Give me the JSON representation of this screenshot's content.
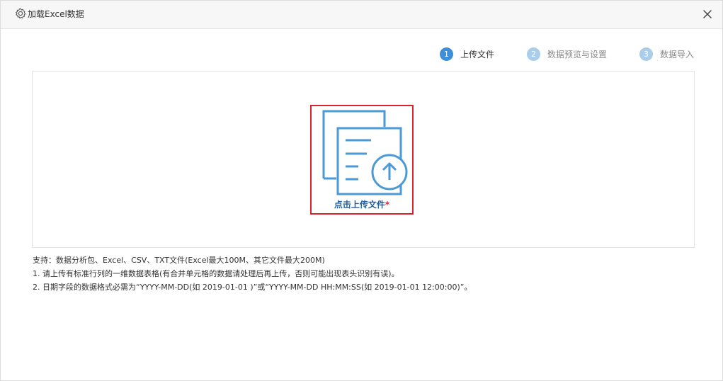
{
  "dialog": {
    "title": "加载Excel数据",
    "title_icon": "gear-icon",
    "close_icon": "close-icon"
  },
  "steps": [
    {
      "num": "1",
      "label": "上传文件",
      "state": "active"
    },
    {
      "num": "2",
      "label": "数据预览与设置",
      "state": "inactive"
    },
    {
      "num": "3",
      "label": "数据导入",
      "state": "inactive"
    }
  ],
  "upload": {
    "label": "点击上传文件",
    "required_mark": "*",
    "icon": "upload-file-icon"
  },
  "notes": {
    "support": "支持：数据分析包、Excel、CSV、TXT文件(Excel最大100M、其它文件最大200M)",
    "line1": "1. 请上传有标准行列的一维数据表格(有合并单元格的数据请处理后再上传，否则可能出现表头识别有误)。",
    "line2": "2. 日期字段的数据格式必需为“YYYY-MM-DD(如 2019-01-01 )”或“YYYY-MM-DD HH:MM:SS(如 2019-01-01 12:00:00)”。"
  },
  "colors": {
    "accent": "#3d8fd9",
    "step_inactive": "#a9cdea",
    "highlight_border": "#d9232e",
    "upload_label": "#1f5fa8"
  }
}
